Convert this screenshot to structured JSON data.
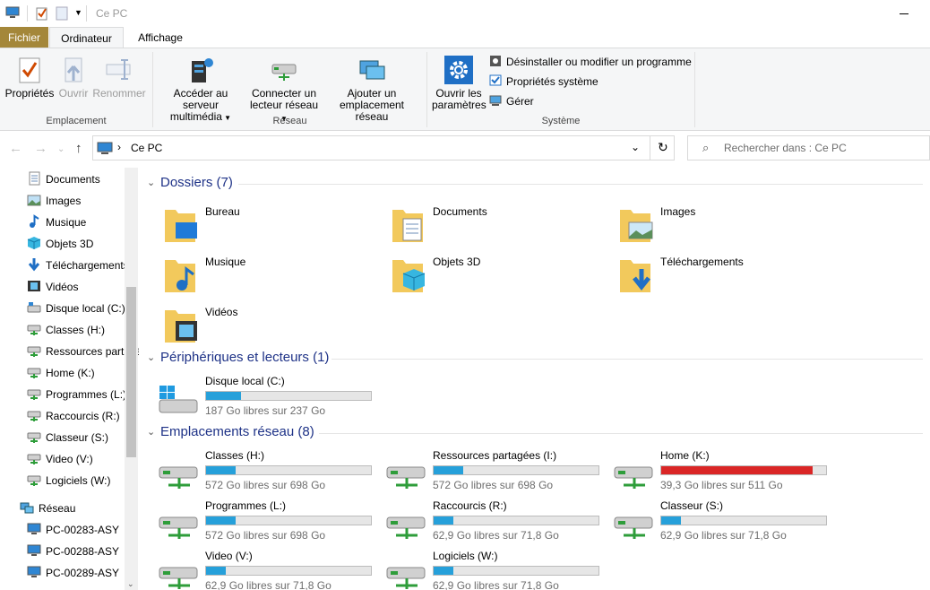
{
  "window": {
    "title": "Ce PC"
  },
  "tabs": {
    "fichier": "Fichier",
    "ordinateur": "Ordinateur",
    "affichage": "Affichage"
  },
  "ribbon": {
    "emplacement": {
      "group_label": "Emplacement",
      "proprietes": "Propriétés",
      "ouvrir": "Ouvrir",
      "renommer": "Renommer"
    },
    "reseau": {
      "group_label": "Réseau",
      "acceder_line1": "Accéder au serveur",
      "acceder_line2": "multimédia",
      "connecter_line1": "Connecter un",
      "connecter_line2": "lecteur réseau",
      "ajouter_line1": "Ajouter un",
      "ajouter_line2": "emplacement réseau"
    },
    "systeme": {
      "group_label": "Système",
      "ouvrir_line1": "Ouvrir les",
      "ouvrir_line2": "paramètres",
      "desinstaller": "Désinstaller ou modifier un programme",
      "proprietes_systeme": "Propriétés système",
      "gerer": "Gérer"
    }
  },
  "address": {
    "path": "Ce PC",
    "search_placeholder": "Rechercher dans : Ce PC"
  },
  "sidebar": {
    "items": [
      {
        "label": "Documents",
        "icon": "document-icon"
      },
      {
        "label": "Images",
        "icon": "images-icon"
      },
      {
        "label": "Musique",
        "icon": "music-icon"
      },
      {
        "label": "Objets 3D",
        "icon": "cube-icon"
      },
      {
        "label": "Téléchargements",
        "icon": "download-icon"
      },
      {
        "label": "Vidéos",
        "icon": "video-icon"
      },
      {
        "label": "Disque local (C:)",
        "icon": "drive-icon"
      },
      {
        "label": "Classes (H:)",
        "icon": "network-drive-icon"
      },
      {
        "label": "Ressources partagées (I:)",
        "icon": "network-drive-icon"
      },
      {
        "label": "Home (K:)",
        "icon": "network-drive-icon"
      },
      {
        "label": "Programmes (L:)",
        "icon": "network-drive-icon"
      },
      {
        "label": "Raccourcis (R:)",
        "icon": "network-drive-icon"
      },
      {
        "label": "Classeur (S:)",
        "icon": "network-drive-icon"
      },
      {
        "label": "Video (V:)",
        "icon": "network-drive-icon"
      },
      {
        "label": "Logiciels (W:)",
        "icon": "network-drive-icon"
      }
    ],
    "network": {
      "label": "Réseau"
    },
    "computers": [
      "PC-00283-ASY",
      "PC-00288-ASY",
      "PC-00289-ASY"
    ]
  },
  "sections": {
    "dossiers": {
      "title": "Dossiers (7)",
      "items": [
        "Bureau",
        "Documents",
        "Images",
        "Musique",
        "Objets 3D",
        "Téléchargements",
        "Vidéos"
      ]
    },
    "peripheriques": {
      "title": "Périphériques et lecteurs (1)",
      "items": [
        {
          "name": "Disque local (C:)",
          "detail": "187 Go libres sur 237 Go",
          "used_fraction": 0.21
        }
      ]
    },
    "reseau": {
      "title": "Emplacements réseau (8)",
      "items": [
        {
          "name": "Classes (H:)",
          "detail": "572 Go libres sur 698 Go",
          "used_fraction": 0.18
        },
        {
          "name": "Ressources partagées (I:)",
          "detail": "572 Go libres sur 698 Go",
          "used_fraction": 0.18
        },
        {
          "name": "Home (K:)",
          "detail": "39,3 Go libres sur 511 Go",
          "used_fraction": 0.92
        },
        {
          "name": "Programmes (L:)",
          "detail": "572 Go libres sur 698 Go",
          "used_fraction": 0.18
        },
        {
          "name": "Raccourcis (R:)",
          "detail": "62,9 Go libres sur 71,8 Go",
          "used_fraction": 0.12
        },
        {
          "name": "Classeur (S:)",
          "detail": "62,9 Go libres sur 71,8 Go",
          "used_fraction": 0.12
        },
        {
          "name": "Video (V:)",
          "detail": "62,9 Go libres sur 71,8 Go",
          "used_fraction": 0.12
        },
        {
          "name": "Logiciels (W:)",
          "detail": "62,9 Go libres sur 71,8 Go",
          "used_fraction": 0.12
        }
      ]
    }
  },
  "colors": {
    "accent": "#26a0da",
    "warning": "#da2626",
    "file_tab": "#a4873a",
    "heading": "#1e3287"
  }
}
